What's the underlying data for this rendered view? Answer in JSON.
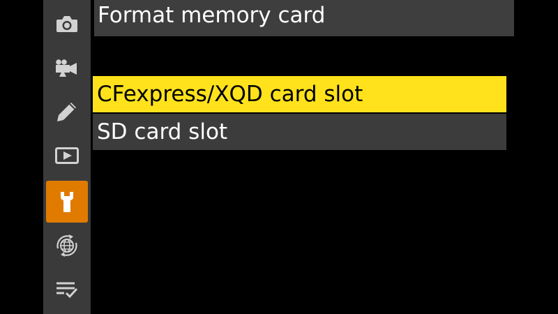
{
  "colors": {
    "sidebar_bg": "#3a3a3a",
    "active_tab": "#e07b00",
    "icon_gray": "#d2d2d2",
    "selected_bg": "#ffe21c",
    "selected_text": "#000000",
    "option_bg": "#3c3c3c",
    "option_text": "#ffffff"
  },
  "sidebar": {
    "tabs": [
      {
        "icon": "camera-icon",
        "active": false
      },
      {
        "icon": "movie-camera-icon",
        "active": false
      },
      {
        "icon": "pencil-icon",
        "active": false
      },
      {
        "icon": "playback-icon",
        "active": false
      },
      {
        "icon": "wrench-icon",
        "active": true
      },
      {
        "icon": "network-globe-icon",
        "active": false
      },
      {
        "icon": "my-menu-icon",
        "active": false
      }
    ]
  },
  "header": {
    "title": "Format memory card"
  },
  "options": [
    {
      "label": "CFexpress/XQD card slot",
      "selected": true
    },
    {
      "label": "SD card slot",
      "selected": false
    }
  ]
}
